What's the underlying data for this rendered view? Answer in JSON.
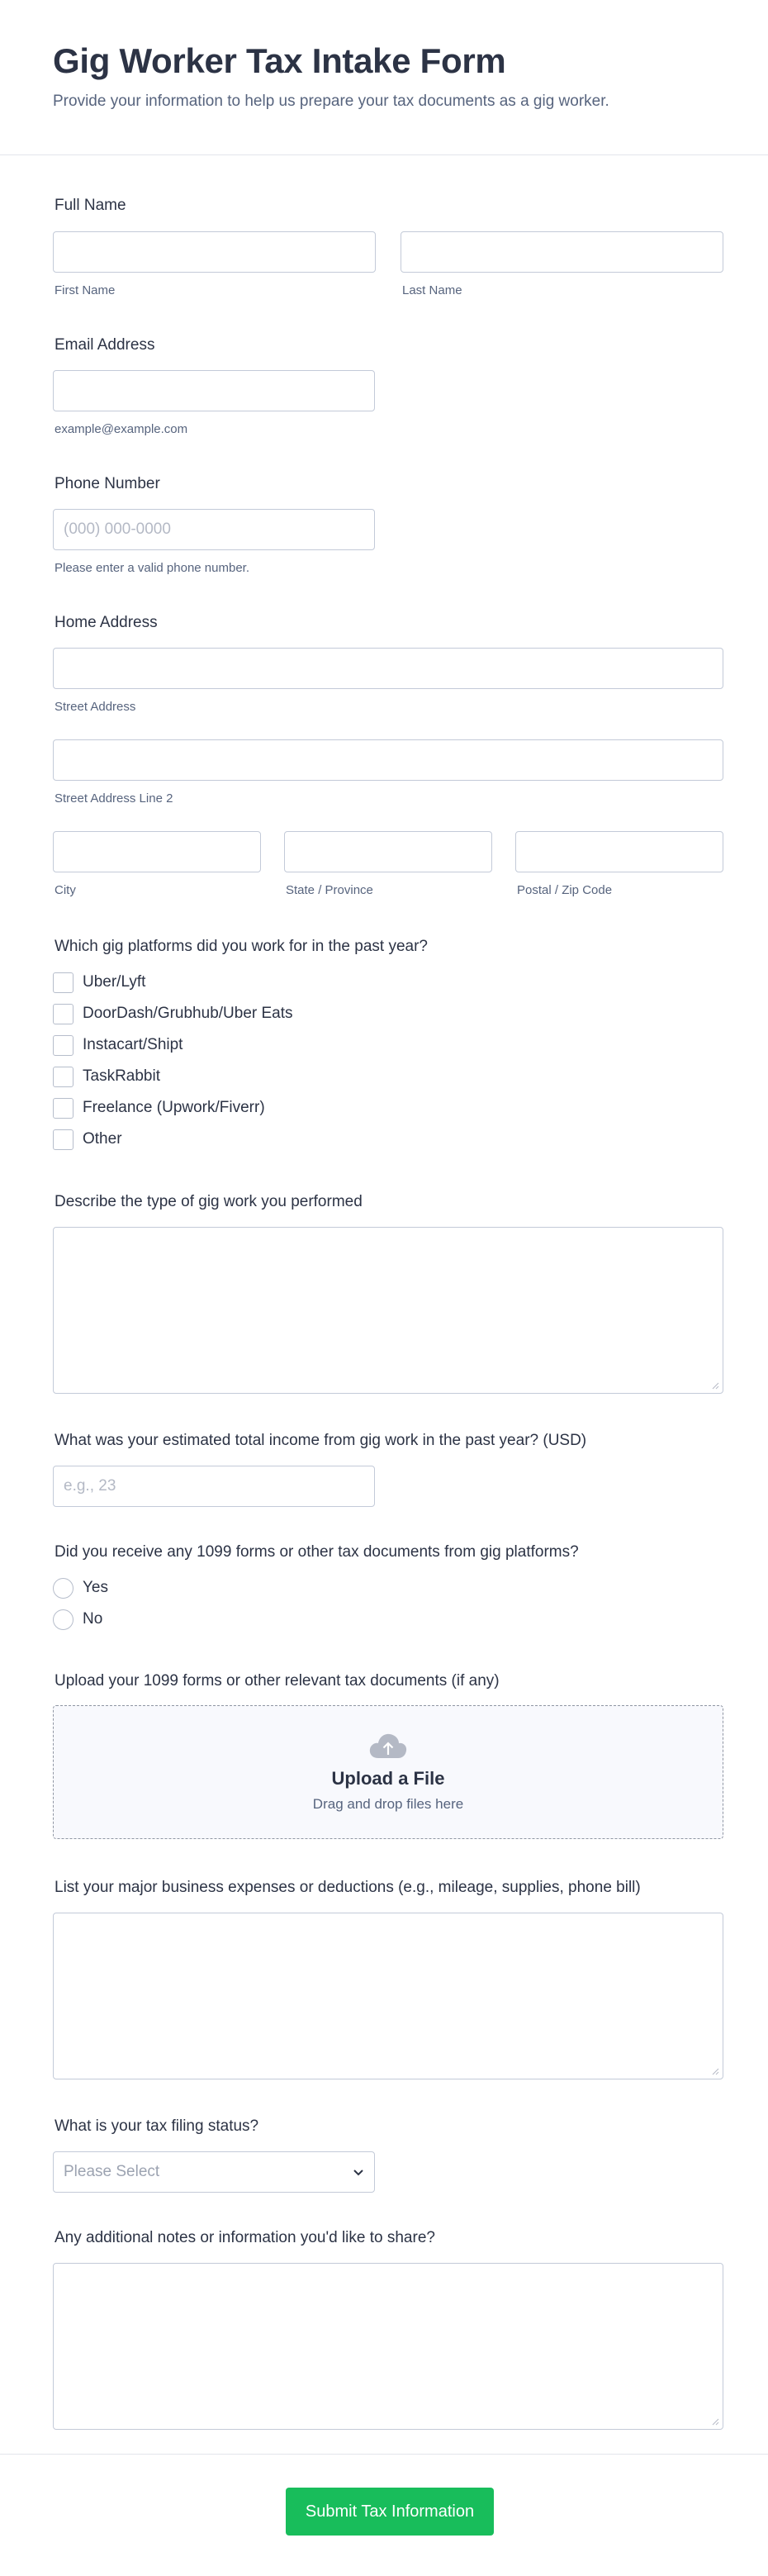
{
  "header": {
    "title": "Gig Worker Tax Intake Form",
    "subtitle": "Provide your information to help us prepare your tax documents as a gig worker."
  },
  "full_name": {
    "label": "Full Name",
    "first_sublabel": "First Name",
    "last_sublabel": "Last Name"
  },
  "email": {
    "label": "Email Address",
    "sublabel": "example@example.com"
  },
  "phone": {
    "label": "Phone Number",
    "placeholder": "(000) 000-0000",
    "sublabel": "Please enter a valid phone number."
  },
  "address": {
    "label": "Home Address",
    "street_sublabel": "Street Address",
    "street2_sublabel": "Street Address Line 2",
    "city_sublabel": "City",
    "state_sublabel": "State / Province",
    "zip_sublabel": "Postal / Zip Code"
  },
  "platforms": {
    "label": "Which gig platforms did you work for in the past year?",
    "options": [
      "Uber/Lyft",
      "DoorDash/Grubhub/Uber Eats",
      "Instacart/Shipt",
      "TaskRabbit",
      "Freelance (Upwork/Fiverr)",
      "Other"
    ]
  },
  "work_description": {
    "label": "Describe the type of gig work you performed"
  },
  "income": {
    "label": "What was your estimated total income from gig work in the past year? (USD)",
    "placeholder": "e.g., 23"
  },
  "forms_1099": {
    "label": "Did you receive any 1099 forms or other tax documents from gig platforms?",
    "options": [
      "Yes",
      "No"
    ]
  },
  "upload": {
    "label": "Upload your 1099 forms or other relevant tax documents (if any)",
    "title": "Upload a File",
    "subtitle": "Drag and drop files here",
    "icon": "cloud-upload-icon"
  },
  "expenses": {
    "label": "List your major business expenses or deductions (e.g., mileage, supplies, phone bill)"
  },
  "filing_status": {
    "label": "What is your tax filing status?",
    "selected": "Please Select"
  },
  "notes": {
    "label": "Any additional notes or information you'd like to share?"
  },
  "submit": {
    "label": "Submit Tax Information",
    "color": "#18bd5b"
  }
}
